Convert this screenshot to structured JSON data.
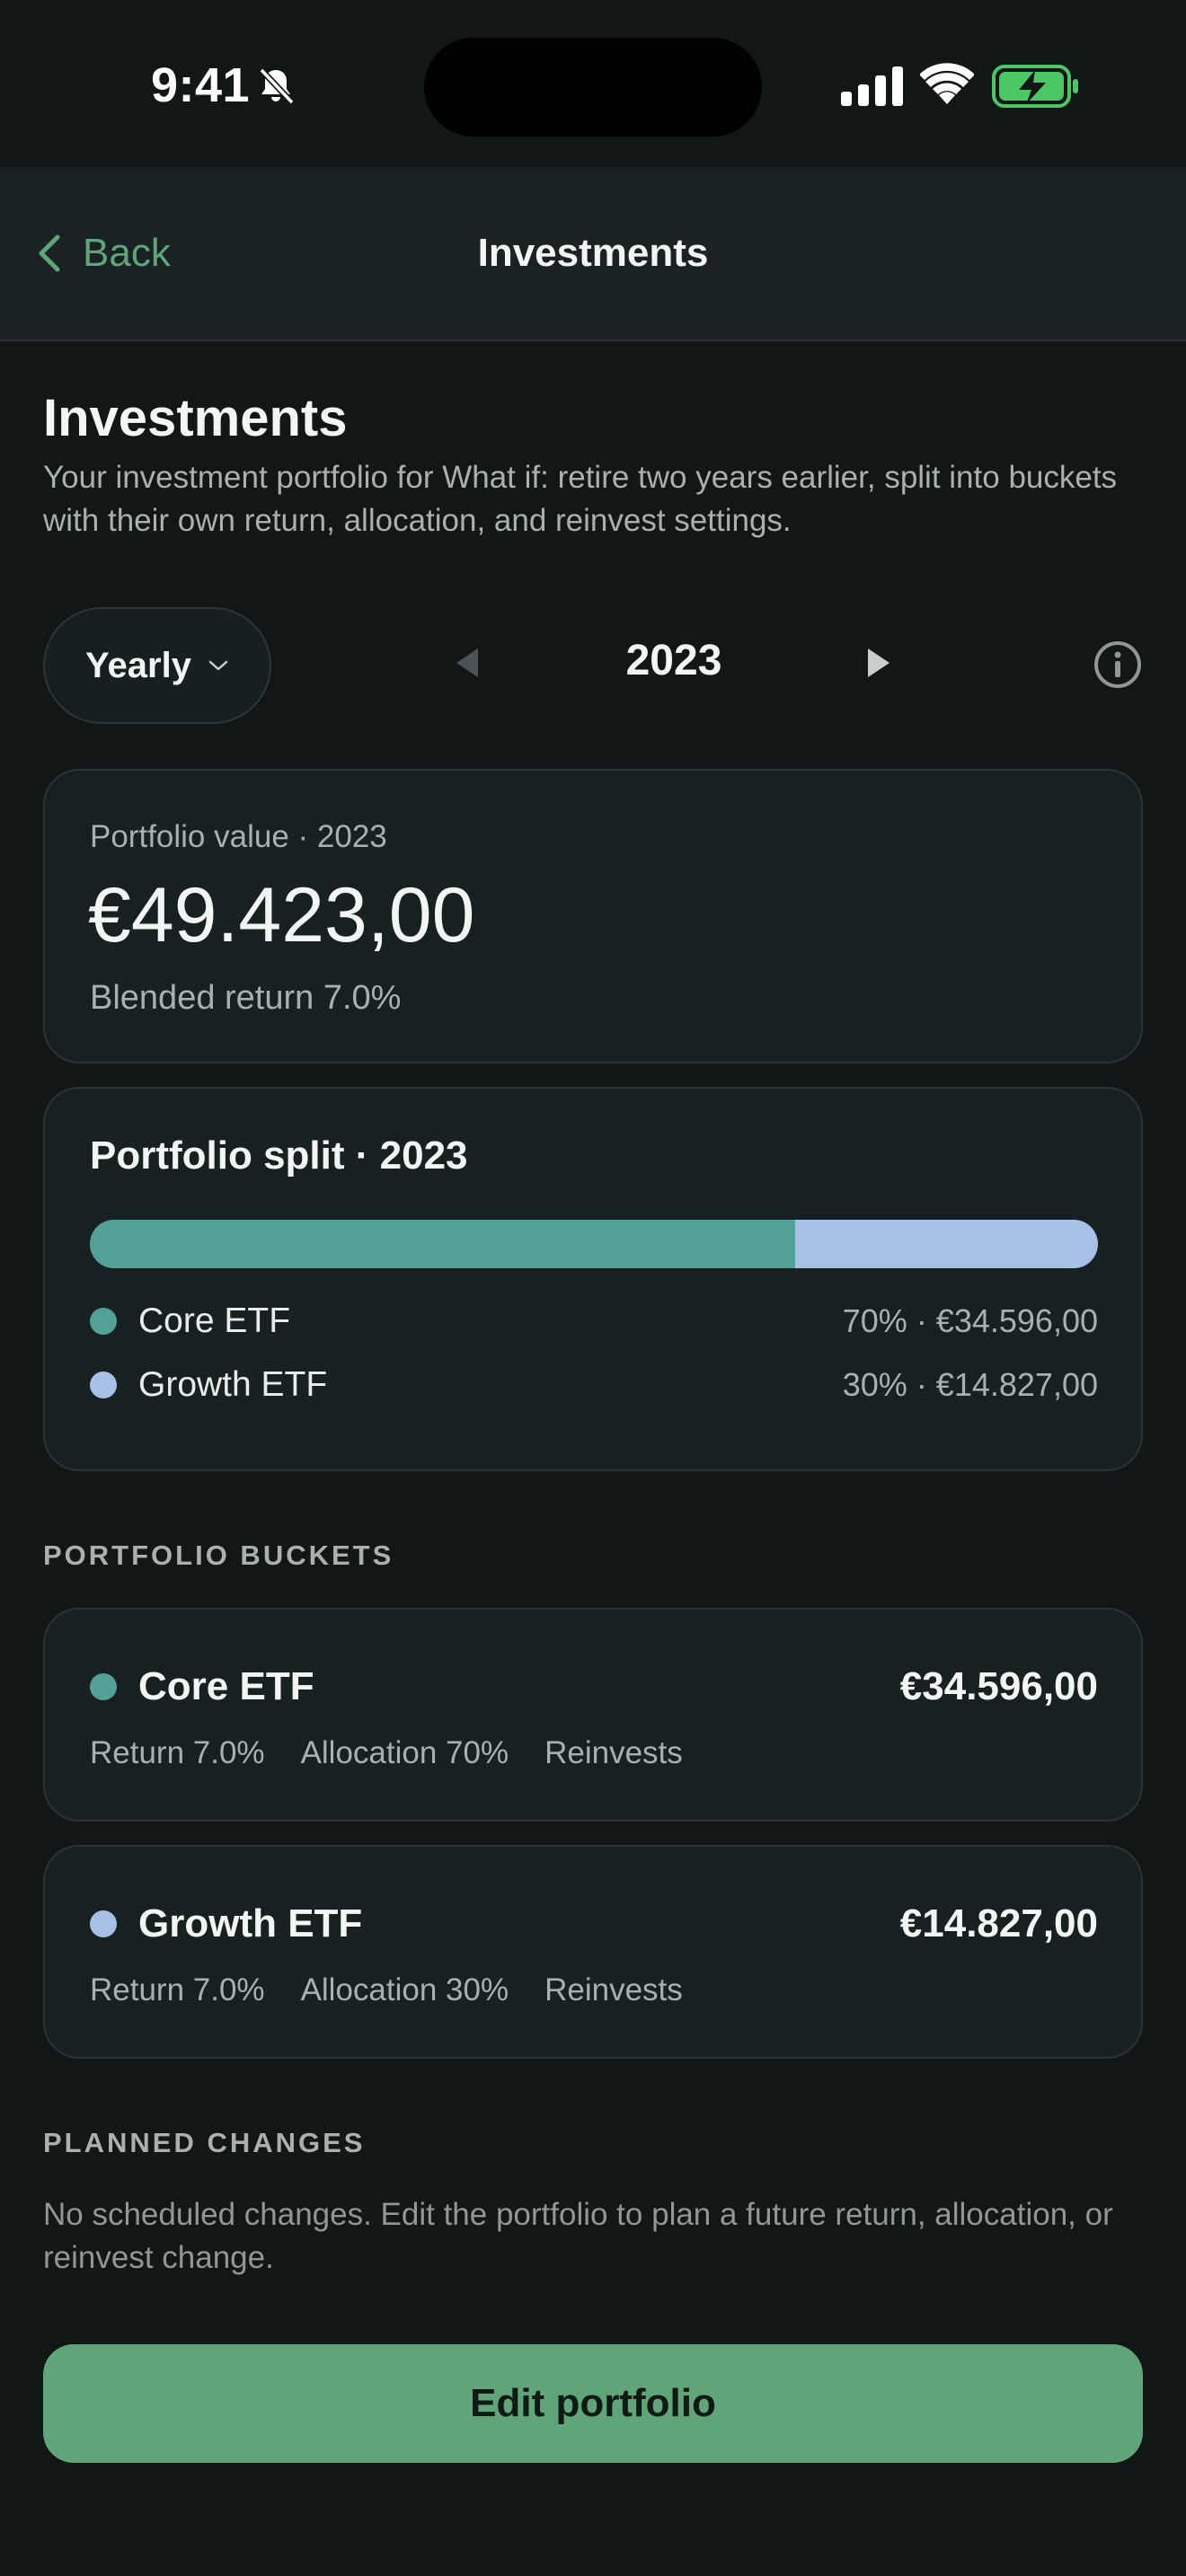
{
  "status_bar": {
    "time": "9:41"
  },
  "nav": {
    "back_label": "Back",
    "title": "Investments"
  },
  "page": {
    "heading": "Investments",
    "subtitle": "Your investment portfolio for What if: retire two years earlier, split into buckets with their own return, allocation, and reinvest settings."
  },
  "period": {
    "selector_label": "Yearly",
    "year": "2023"
  },
  "portfolio_value": {
    "label": "Portfolio value · 2023",
    "value": "€49.423,00",
    "blended_return": "Blended return 7.0%"
  },
  "portfolio_split": {
    "title": "Portfolio split · 2023",
    "segments": [
      {
        "name": "Core ETF",
        "fraction": 0.7,
        "color": "#53a196",
        "summary": "70% · €34.596,00"
      },
      {
        "name": "Growth ETF",
        "fraction": 0.3,
        "color": "#a9c0e6",
        "summary": "30% · €14.827,00"
      }
    ]
  },
  "buckets": {
    "section_label": "PORTFOLIO BUCKETS",
    "items": [
      {
        "name": "Core ETF",
        "value": "€34.596,00",
        "color": "#53a196",
        "return": "Return 7.0%",
        "allocation": "Allocation 70%",
        "reinvest": "Reinvests"
      },
      {
        "name": "Growth ETF",
        "value": "€14.827,00",
        "color": "#a9c0e6",
        "return": "Return 7.0%",
        "allocation": "Allocation 30%",
        "reinvest": "Reinvests"
      }
    ]
  },
  "planned_changes": {
    "section_label": "PLANNED CHANGES",
    "empty_text": "No scheduled changes. Edit the portfolio to plan a future return, allocation, or reinvest change."
  },
  "actions": {
    "edit_label": "Edit portfolio"
  },
  "colors": {
    "accent": "#5fa579",
    "background": "#111617",
    "card": "#182122"
  }
}
